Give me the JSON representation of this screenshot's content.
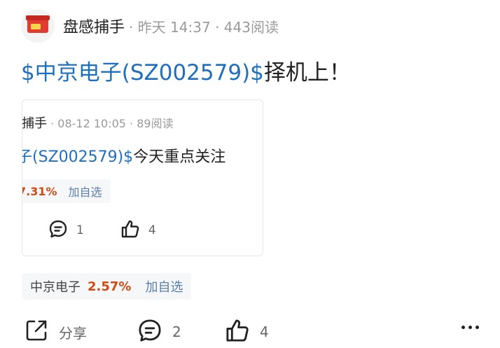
{
  "post": {
    "author": "盘感捕手",
    "meta": " · 昨天 14:37 · 443阅读",
    "title_stock": "$中京电子(SZ002579)$",
    "title_rest": "择机上！"
  },
  "quoted_post": {
    "author_partial": "捕手",
    "meta": " · 08-12 10:05 · 89阅读",
    "title_stock_partial": "子(SZ002579)$",
    "title_rest_partial": "今天重点关注",
    "stock_pct_partial": "7.31%",
    "add_label": "加自选",
    "comments": "1",
    "likes": "4"
  },
  "stock_chip": {
    "name": "中京电子",
    "pct": "2.57%",
    "add_label": "加自选"
  },
  "actions": {
    "share_label": "分享",
    "comments": "2",
    "likes": "4"
  },
  "colors": {
    "link": "#1f6fbf",
    "up": "#d14b14"
  }
}
